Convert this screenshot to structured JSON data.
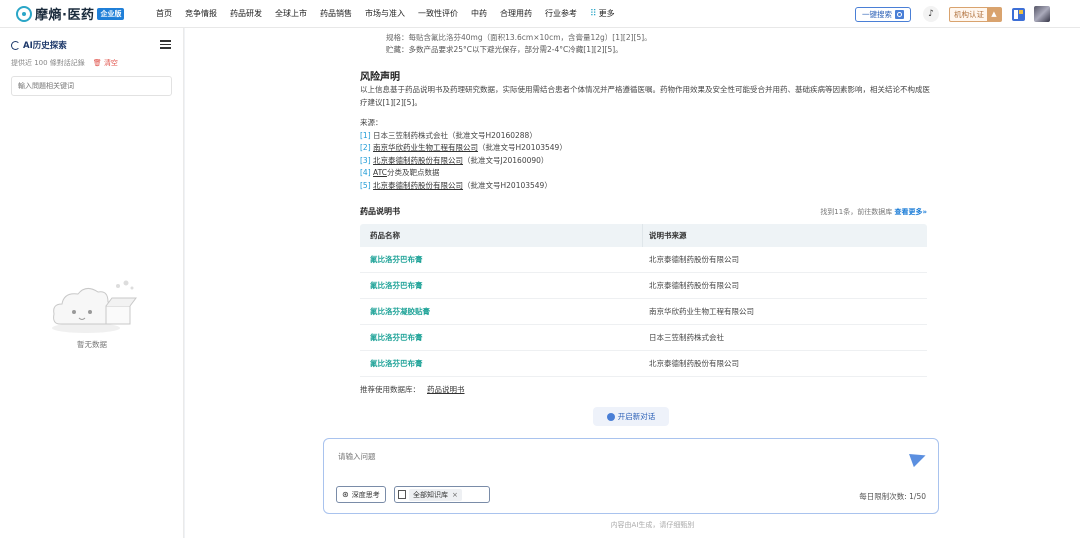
{
  "header": {
    "logo_text": "摩熵·医药",
    "logo_badge": "企业版",
    "nav": [
      "首页",
      "竞争情报",
      "药品研发",
      "全球上市",
      "药品销售",
      "市场与准入",
      "一致性评价",
      "中药",
      "合理用药",
      "行业参考"
    ],
    "nav_more": "更多",
    "search_btn": "一键搜索",
    "org_btn": "机构认证"
  },
  "sidebar": {
    "title": "AI历史探索",
    "subtitle": "提供近 100 條對話記錄",
    "clear": "清空",
    "search_placeholder": "輸入問題相关键词",
    "empty_text": "暫无数据"
  },
  "content": {
    "top_line1": "规格：每贴含氟比洛芬40mg（面积13.6cm×10cm，含膏量12g）[1][2][5]。",
    "top_line2": "贮藏：多数产品要求25°C以下避光保存，部分需2-4°C冷藏[1][2][5]。",
    "risk_title": "风险声明",
    "risk_body": "以上信息基于药品说明书及药理研究数据，实际使用需结合患者个体情况并严格遵循医嘱。药物作用效果及安全性可能受合并用药、基础疾病等因素影响，相关结论不构成医疗建议[1][2][5]。",
    "sources_label": "来源：",
    "sources": [
      {
        "ref": "[1]",
        "link": "",
        "text": "日本三笠制药株式会社（批准文号H20160288）"
      },
      {
        "ref": "[2]",
        "link": "南京华欣药业生物工程有限公司",
        "text": "（批准文号H20103549）"
      },
      {
        "ref": "[3]",
        "link": "北京泰德制药股份有限公司",
        "text": "（批准文号J20160090）"
      },
      {
        "ref": "[4]",
        "link": "ATC",
        "text": "分类及靶点数据"
      },
      {
        "ref": "[5]",
        "link": "北京泰德制药股份有限公司",
        "text": "（批准文号H20103549）"
      }
    ]
  },
  "table": {
    "title": "药品说明书",
    "meta": "找到11条，前往数据库",
    "more": "查看更多»",
    "columns": [
      "药品名称",
      "说明书来源"
    ],
    "rows": [
      {
        "name": "氟比洛芬巴布膏",
        "source": "北京泰德制药股份有限公司"
      },
      {
        "name": "氟比洛芬巴布膏",
        "source": "北京泰德制药股份有限公司"
      },
      {
        "name": "氟比洛芬凝胶贴膏",
        "source": "南京华欣药业生物工程有限公司"
      },
      {
        "name": "氟比洛芬巴布膏",
        "source": "日本三笠制药株式会社"
      },
      {
        "name": "氟比洛芬巴布膏",
        "source": "北京泰德制药股份有限公司"
      }
    ],
    "recommend_label": "推荐使用数据库：",
    "recommend_db": "药品说明书"
  },
  "new_chat": "开启新对话",
  "composer": {
    "placeholder": "请输入问题",
    "deep_think": "深度思考",
    "kb_tag": "全部知识库",
    "limit": "每日限制次数: 1/50"
  },
  "footnote": "内容由AI生成，请仔细甄别"
}
